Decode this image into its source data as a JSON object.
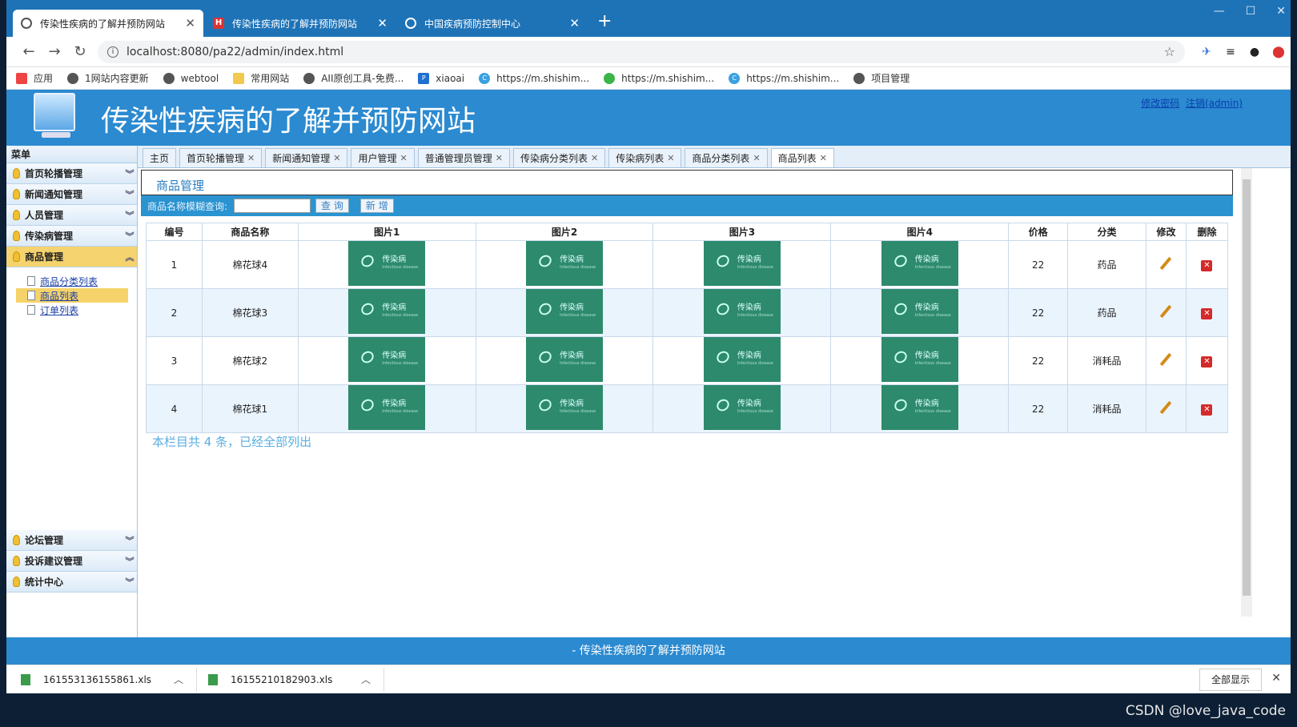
{
  "browser": {
    "tabs": [
      {
        "title": "传染性疾病的了解并预防网站",
        "active": true
      },
      {
        "title": "传染性疾病的了解并预防网站",
        "active": false
      },
      {
        "title": "中国疾病预防控制中心",
        "active": false
      }
    ],
    "url": "localhost:8080/pa22/admin/index.html",
    "bookmarks": [
      "应用",
      "1网站内容更新",
      "webtool",
      "常用网站",
      "AII原创工具-免费...",
      "xiaoai",
      "https://m.shishim...",
      "https://m.shishim...",
      "https://m.shishim...",
      "项目管理"
    ]
  },
  "site": {
    "title": "传染性疾病的了解并预防网站",
    "change_pwd": "修改密码",
    "logout": "注销(admin)"
  },
  "sidebar": {
    "menu_label": "菜单",
    "groups": [
      "首页轮播管理",
      "新闻通知管理",
      "人员管理",
      "传染病管理",
      "商品管理"
    ],
    "submenu": [
      "商品分类列表",
      "商品列表",
      "订单列表"
    ],
    "bottom_groups": [
      "论坛管理",
      "投诉建议管理",
      "统计中心"
    ]
  },
  "content_tabs": [
    "主页",
    "首页轮播管理",
    "新闻通知管理",
    "用户管理",
    "普通管理员管理",
    "传染病分类列表",
    "传染病列表",
    "商品分类列表",
    "商品列表"
  ],
  "page": {
    "title": "商品管理",
    "search_label": "商品名称模糊查询:",
    "query_btn": "查 询",
    "add_btn": "新 增",
    "summary": "本栏目共 4 条，已经全部列出"
  },
  "table": {
    "headers": [
      "编号",
      "商品名称",
      "图片1",
      "图片2",
      "图片3",
      "图片4",
      "价格",
      "分类",
      "修改",
      "删除"
    ],
    "thumb_text": "传染病",
    "thumb_sub": "Infectious disease",
    "rows": [
      {
        "id": "1",
        "name": "棉花球4",
        "price": "22",
        "category": "药品"
      },
      {
        "id": "2",
        "name": "棉花球3",
        "price": "22",
        "category": "药品"
      },
      {
        "id": "3",
        "name": "棉花球2",
        "price": "22",
        "category": "消耗品"
      },
      {
        "id": "4",
        "name": "棉花球1",
        "price": "22",
        "category": "消耗品"
      }
    ]
  },
  "footer": {
    "text": "- 传染性疾病的了解并预防网站"
  },
  "downloads": {
    "files": [
      "161553136155861.xls",
      "16155210182903.xls"
    ],
    "show_all": "全部显示"
  },
  "watermark": "CSDN @love_java_code"
}
